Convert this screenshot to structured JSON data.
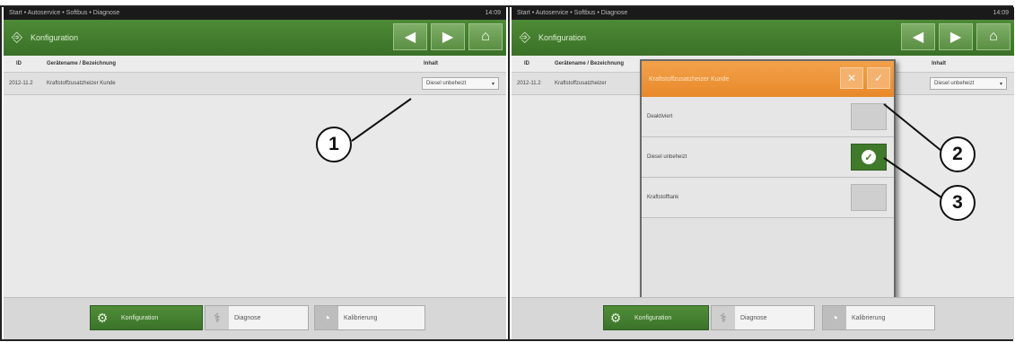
{
  "left": {
    "sysbar": {
      "left": "Start • Autoservice • Softbus • Diagnose",
      "right": "14:09"
    },
    "title": "Konfiguration",
    "table": {
      "headers": {
        "id": "ID",
        "desc": "Gerätename / Bezeichnung",
        "content": "Inhalt"
      },
      "row": {
        "id": "2012-11.2",
        "desc": "Kraftstoffzusatzheizer Kunde",
        "value": "Diesel unbeheizt"
      }
    },
    "bottom": {
      "btn1": "Konfiguration",
      "btn2": "Diagnose",
      "btn3": "Kalibrierung"
    }
  },
  "right": {
    "sysbar": {
      "left": "Start • Autoservice • Softbus • Diagnose",
      "right": "14:09"
    },
    "title": "Konfiguration",
    "table": {
      "headers": {
        "id": "ID",
        "desc": "Gerätename / Bezeichnung",
        "content": "Inhalt"
      },
      "row": {
        "id": "2012-11.2",
        "desc": "Kraftstoffzusatzheizer",
        "value": "Diesel unbeheizt"
      }
    },
    "dialog": {
      "title": "Kraftstoffzusatzheizer Kunde",
      "options": [
        "Deaktiviert",
        "Diesel unbeheizt",
        "Kraftstofftank"
      ]
    },
    "bottom": {
      "btn1": "Konfiguration",
      "btn2": "Diagnose",
      "btn3": "Kalibrierung"
    }
  },
  "callouts": {
    "c1": "1",
    "c2": "2",
    "c3": "3"
  },
  "icons": {
    "app": "door-exit-icon",
    "back": "arrow-left-icon",
    "forward": "arrow-right-icon",
    "home": "home-icon",
    "config": "gear-icon",
    "diagnose": "stethoscope-icon",
    "calibrate": "gauge-icon",
    "check": "check-icon"
  },
  "colors": {
    "green": "#3f7a2b",
    "orange": "#ea8e2e",
    "gray": "#e9e9e9"
  }
}
